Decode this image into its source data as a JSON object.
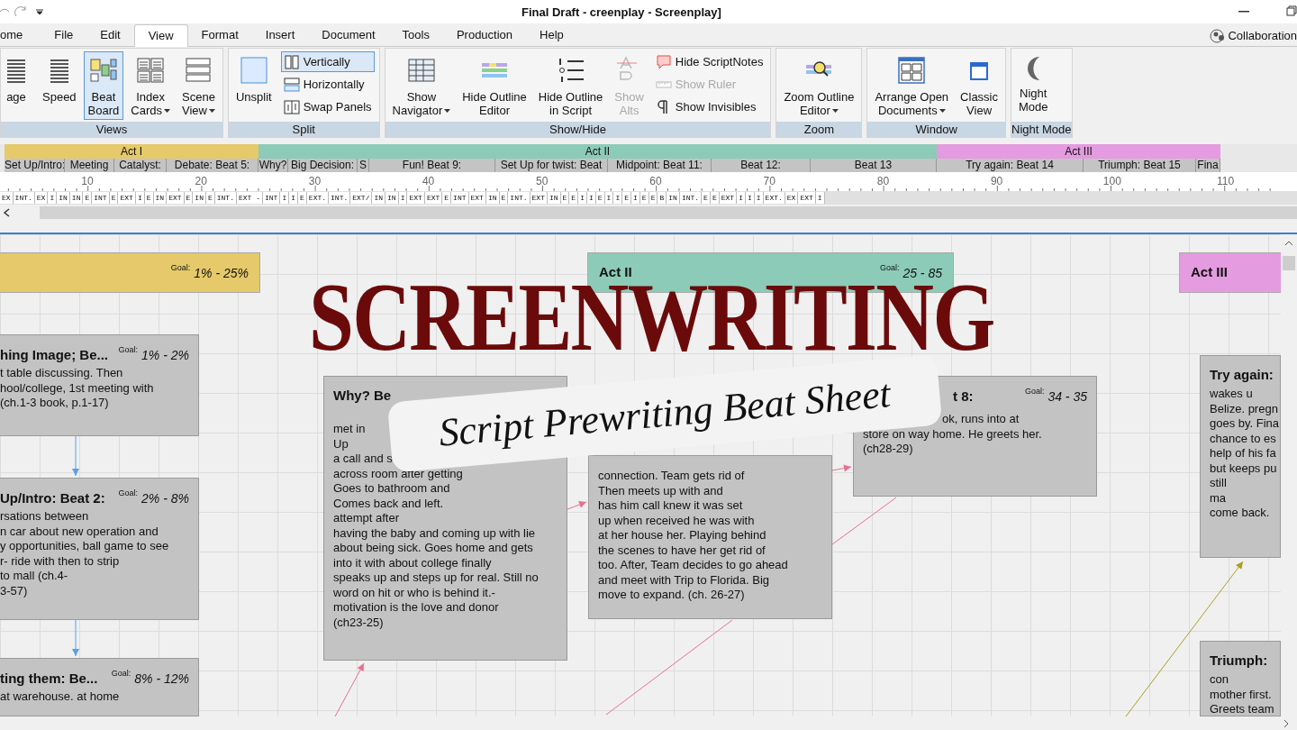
{
  "window": {
    "title": "Final Draft - creenplay - Screenplay]"
  },
  "menu": {
    "tabs": [
      {
        "label": "ome",
        "selected": false
      },
      {
        "label": "File",
        "selected": false
      },
      {
        "label": "Edit",
        "selected": false
      },
      {
        "label": "View",
        "selected": true
      },
      {
        "label": "Format",
        "selected": false
      },
      {
        "label": "Insert",
        "selected": false
      },
      {
        "label": "Document",
        "selected": false
      },
      {
        "label": "Tools",
        "selected": false
      },
      {
        "label": "Production",
        "selected": false
      },
      {
        "label": "Help",
        "selected": false
      }
    ],
    "collaboration": "Collaboration"
  },
  "ribbon": {
    "groups": [
      {
        "label": "Views",
        "items": [
          {
            "kind": "large",
            "lines": [
              "age"
            ],
            "selected": false,
            "dropdown": false,
            "disabled": false
          },
          {
            "kind": "large",
            "lines": [
              "Speed"
            ],
            "selected": false,
            "dropdown": false,
            "disabled": false
          },
          {
            "kind": "large",
            "lines": [
              "Beat",
              "Board"
            ],
            "selected": true,
            "dropdown": false,
            "disabled": false
          },
          {
            "kind": "large",
            "lines": [
              "Index",
              "Cards"
            ],
            "selected": false,
            "dropdown": true,
            "disabled": false
          },
          {
            "kind": "large",
            "lines": [
              "Scene",
              "View"
            ],
            "selected": false,
            "dropdown": true,
            "disabled": false
          }
        ]
      },
      {
        "label": "Split",
        "items": [
          {
            "kind": "large",
            "lines": [
              "Unsplit"
            ],
            "selected": false,
            "dropdown": false,
            "disabled": false
          },
          {
            "kind": "stack",
            "items": [
              {
                "label": "Vertically",
                "selected": true,
                "disabled": false
              },
              {
                "label": "Horizontally",
                "selected": false,
                "disabled": false
              },
              {
                "label": "Swap Panels",
                "selected": false,
                "disabled": false
              }
            ]
          }
        ]
      },
      {
        "label": "Show/Hide",
        "items": [
          {
            "kind": "large",
            "lines": [
              "Show",
              "Navigator"
            ],
            "selected": false,
            "dropdown": true,
            "disabled": false
          },
          {
            "kind": "large",
            "lines": [
              "Hide Outline",
              "Editor"
            ],
            "selected": false,
            "dropdown": false,
            "disabled": false
          },
          {
            "kind": "large",
            "lines": [
              "Hide Outline",
              "in Script"
            ],
            "selected": false,
            "dropdown": false,
            "disabled": false
          },
          {
            "kind": "large",
            "lines": [
              "Show",
              "Alts"
            ],
            "selected": false,
            "dropdown": false,
            "disabled": true
          },
          {
            "kind": "stack",
            "items": [
              {
                "label": "Hide ScriptNotes",
                "selected": false,
                "disabled": false
              },
              {
                "label": "Show Ruler",
                "selected": false,
                "disabled": true
              },
              {
                "label": "Show Invisibles",
                "selected": false,
                "disabled": false
              }
            ]
          }
        ]
      },
      {
        "label": "Zoom",
        "items": [
          {
            "kind": "large",
            "lines": [
              "Zoom Outline",
              "Editor"
            ],
            "selected": false,
            "dropdown": true,
            "disabled": false
          }
        ]
      },
      {
        "label": "Window",
        "items": [
          {
            "kind": "large",
            "lines": [
              "Arrange Open",
              "Documents"
            ],
            "selected": false,
            "dropdown": true,
            "disabled": false
          },
          {
            "kind": "large",
            "lines": [
              "Classic",
              "View"
            ],
            "selected": false,
            "dropdown": false,
            "disabled": false
          }
        ]
      },
      {
        "label": "Night Mode",
        "items": [
          {
            "kind": "large",
            "lines": [
              "Night",
              "Mode"
            ],
            "selected": false,
            "dropdown": false,
            "disabled": false
          }
        ]
      }
    ]
  },
  "timeline": {
    "acts": [
      {
        "label": "Act I",
        "color": "#e5c96a"
      },
      {
        "label": "Act II",
        "color": "#8ccbb7"
      },
      {
        "label": "Act III",
        "color": "#e49be0"
      }
    ],
    "beats": [
      "Set Up/Intro:",
      "Meeting",
      "Catalyst:",
      "Debate: Beat 5:",
      "Why?",
      "Big Decision:",
      "S",
      "Fun! Beat 9:",
      "Set Up for twist: Beat",
      "Midpoint: Beat 11:",
      "Beat 12:",
      "Beat 13",
      "Try again: Beat 14",
      "Triumph: Beat 15",
      "Fina"
    ],
    "ruler": [
      "10",
      "20",
      "30",
      "40",
      "50",
      "60",
      "70",
      "80",
      "90",
      "100",
      "110"
    ],
    "scenes": [
      "EX",
      "INT.",
      "EX",
      "I",
      "IN",
      "IN",
      "E",
      "INT",
      "E",
      "EXT",
      "I",
      "E",
      "IN",
      "EXT",
      "E",
      "IN",
      "E",
      "INT.",
      "EXT -",
      "INT",
      "I",
      "I",
      "E",
      "EXT.",
      "INT.",
      "EXT/",
      "IN",
      "IN",
      "I",
      "EXT",
      "EXT",
      "E",
      "INT",
      "EXT",
      "IN",
      "E",
      "INT.",
      "EXT",
      "IN",
      "E",
      "E",
      "I",
      "I",
      "E",
      "I",
      "I",
      "E",
      "I",
      "E",
      "E",
      "B",
      "IN",
      "INT.",
      "E",
      "E",
      "EXT",
      "I",
      "I",
      "I",
      "EXT.",
      "EX",
      "EXT",
      "I"
    ]
  },
  "beat_board": {
    "acts": [
      {
        "goal_label": "Goal:",
        "goal": "1% - 25%",
        "color": "#e5c96a"
      },
      {
        "label": "Act II",
        "goal_label": "Goal:",
        "goal": "25 - 85",
        "color": "#8ccbb7"
      },
      {
        "label": "Act III",
        "color": "#e49be0"
      }
    ],
    "cards": [
      {
        "title": "hing Image; Be...",
        "goal_label": "Goal:",
        "goal": "1% - 2%",
        "lines": [
          "t table discussing. Then",
          "hool/college, 1st meeting with",
          "(ch.1-3 book, p.1-17)"
        ]
      },
      {
        "title": "Up/Intro: Beat 2:",
        "goal_label": "Goal:",
        "goal": "2% - 8%",
        "lines": [
          "rsations between",
          "n car about new operation and",
          "y opportunities, ball game to see",
          "r- ride with then to strip",
          "to mall (ch.4-",
          "3-57)"
        ]
      },
      {
        "title": "ting them: Be...",
        "goal_label": "Goal:",
        "goal": "8% - 12%",
        "lines": [
          "at warehouse. at home"
        ]
      },
      {
        "title": "Why? Be",
        "lines": [
          "met in",
          "Up",
          "a call and s",
          "across room after getting",
          "Goes to bathroom and",
          "Comes back and left.",
          "attempt after",
          "having the baby and coming up with lie",
          "about being sick. Goes home and gets",
          "into it with about college finally",
          "speaks up and steps up for real. Still no",
          "word on hit or who is behind it.-",
          "motivation is the love and donor",
          "(ch23-25)"
        ]
      },
      {
        "lines": [
          "connection. Team gets rid of",
          "Then meets up with and",
          "has him call knew it was set",
          "up when received he was with",
          "at her house her. Playing behind",
          "the scenes to have her get rid of",
          "too. After, Team decides to go ahead",
          "and meet with Trip to Florida. Big",
          "move to expand. (ch. 26-27)"
        ]
      },
      {
        "title": "t 8:",
        "goal_label": "Goal:",
        "goal": "34 - 35",
        "lines": [
          "ok, runs into at",
          "store on way home. He greets her.",
          "(ch28-29)"
        ]
      },
      {
        "title": "Try again:",
        "lines": [
          "wakes u",
          "Belize. pregn",
          "goes by. Fina",
          "chance to es",
          "help of his fa",
          "but keeps pu",
          "still",
          "ma",
          "come back."
        ]
      },
      {
        "title": "Triumph:",
        "lines": [
          "con",
          "mother first.",
          "Greets team"
        ]
      }
    ]
  },
  "overlay": {
    "headline": "SCREENWRITING",
    "subtitle": "Script Prewriting Beat Sheet"
  }
}
